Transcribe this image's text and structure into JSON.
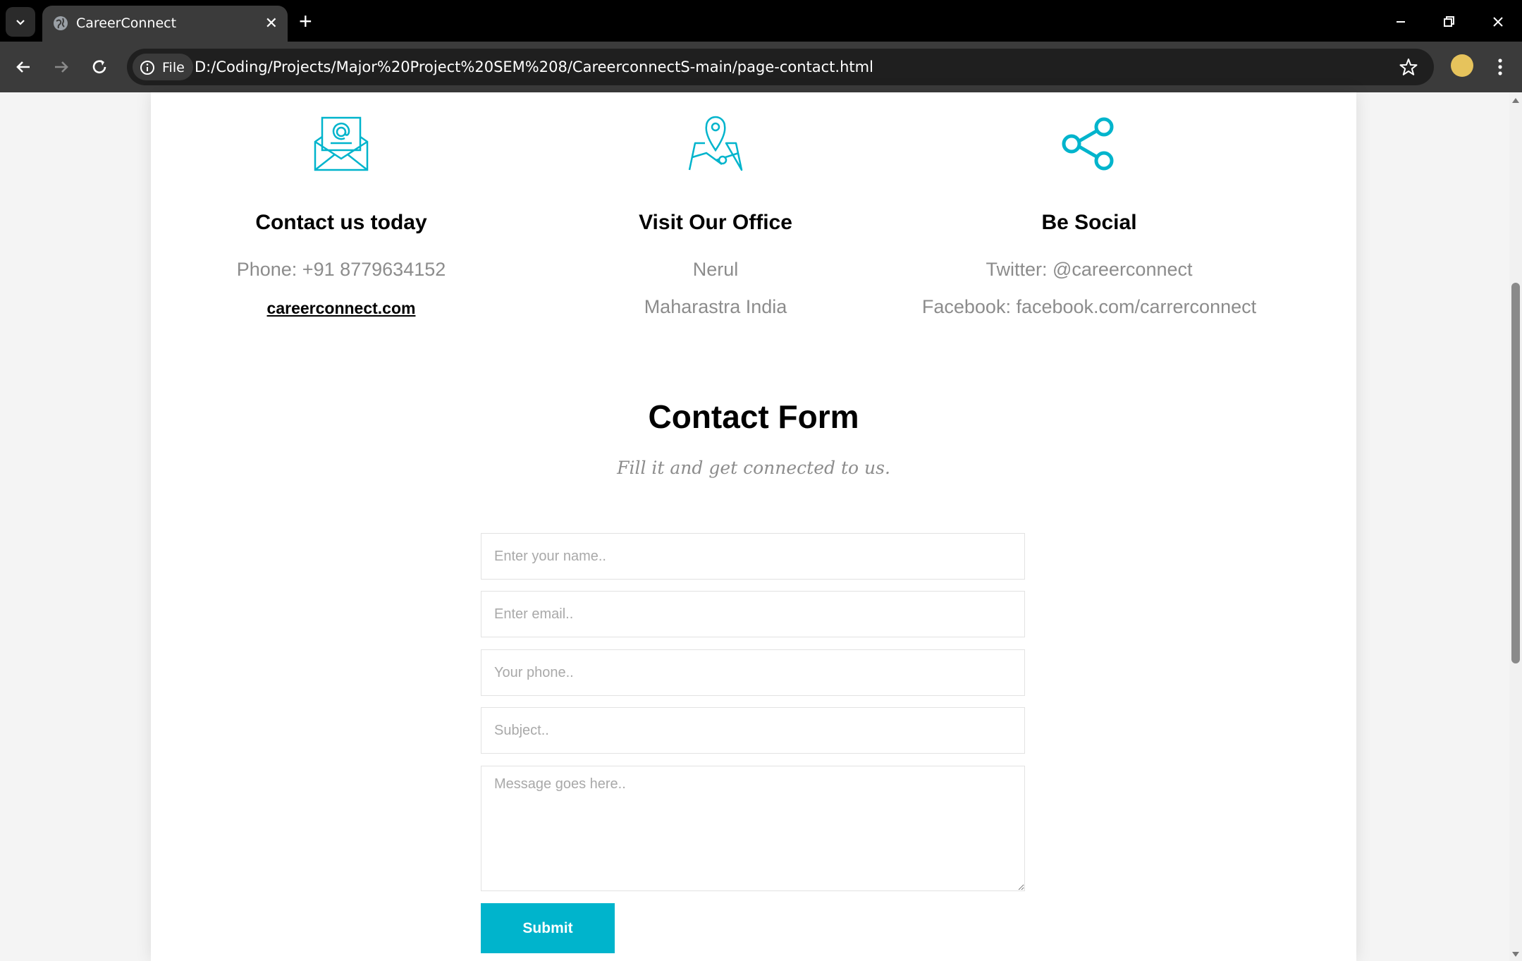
{
  "browser": {
    "tab_title": "CareerConnect",
    "new_tab_symbol": "+",
    "close_symbol": "✕",
    "site_info_label": "File",
    "url": "D:/Coding/Projects/Major%20Project%20SEM%208/CareerconnectS-main/page-contact.html"
  },
  "contact_info": {
    "email_col": {
      "icon": "envelope-at-icon",
      "title": "Contact us today",
      "phone": "Phone: +91 8779634152",
      "link": "careerconnect.com"
    },
    "office_col": {
      "icon": "map-pin-icon",
      "title": "Visit Our Office",
      "line1": "Nerul",
      "line2": "Maharastra India"
    },
    "social_col": {
      "icon": "share-icon",
      "title": "Be Social",
      "twitter": "Twitter: @careerconnect",
      "facebook": "Facebook: facebook.com/carrerconnect"
    }
  },
  "form": {
    "title": "Contact Form",
    "subtitle": "Fill it and get connected to us.",
    "name_placeholder": "Enter your name..",
    "email_placeholder": "Enter email..",
    "phone_placeholder": "Your phone..",
    "subject_placeholder": "Subject..",
    "message_placeholder": "Message goes here..",
    "submit_label": "Submit"
  },
  "colors": {
    "accent": "#00b4cc",
    "muted_text": "#8c8c8c"
  }
}
